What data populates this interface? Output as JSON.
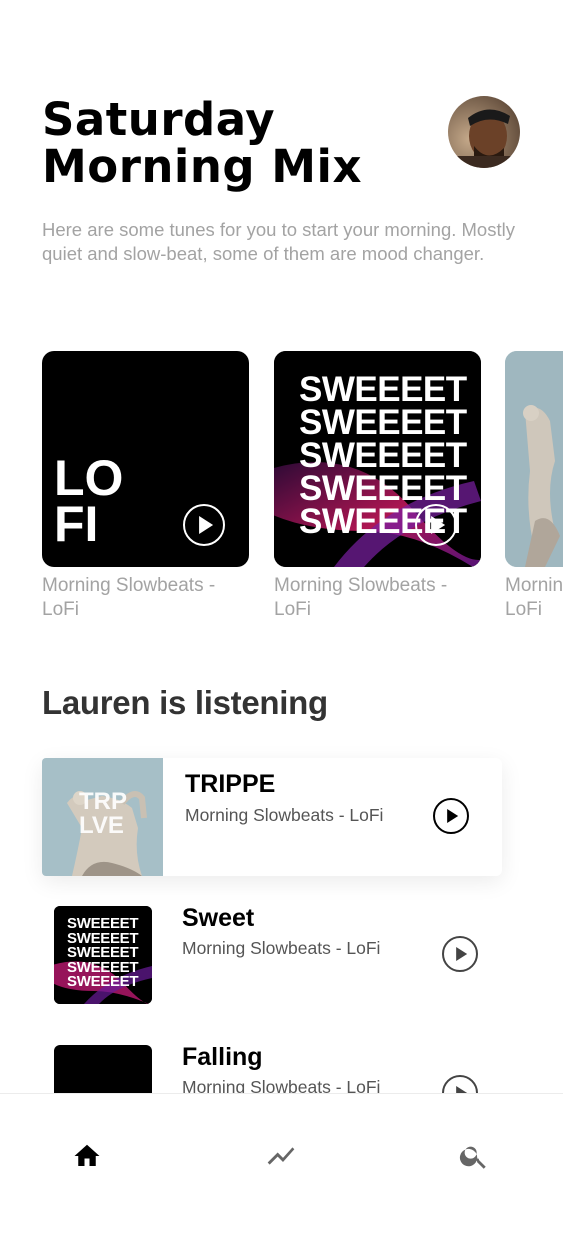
{
  "header": {
    "title_line1": "Saturday",
    "title_line2": "Morning Mix",
    "subtitle": "Here are some tunes for you to start your morning. Mostly quiet and slow-beat, some of them are mood changer."
  },
  "carousel": {
    "cards": [
      {
        "art_lines": [
          "LO",
          "FI"
        ],
        "caption": "Morning Slowbeats - LoFi",
        "icon": "play-circle-icon"
      },
      {
        "art_lines": [
          "SWEEEET",
          "SWEEEET",
          "SWEEEET",
          "SWEEEET",
          "SWEEEET"
        ],
        "caption": "Morning Slowbeats - LoFi",
        "icon": "play-circle-icon"
      },
      {
        "art_lines": [],
        "caption": "Morning Slowbeats - LoFi"
      }
    ]
  },
  "listening": {
    "heading": "Lauren is listening",
    "tracks": [
      {
        "title": "TRIPPE",
        "subtitle": "Morning Slowbeats - LoFi",
        "art_lines": [
          "TRP",
          "LVE"
        ],
        "featured": true
      },
      {
        "title": "Sweet",
        "subtitle": "Morning Slowbeats - LoFi",
        "art_lines": [
          "SWEEEET",
          "SWEEEET",
          "SWEEEET",
          "SWEEEET",
          "SWEEEET"
        ]
      },
      {
        "title": "Falling",
        "subtitle": "Morning Slowbeats - LoFi"
      }
    ]
  },
  "nav": {
    "items": [
      {
        "icon": "home-icon",
        "active": true
      },
      {
        "icon": "trending-icon",
        "active": false
      },
      {
        "icon": "search-icon",
        "active": false
      }
    ]
  },
  "colors": {
    "primary_text": "#000000",
    "secondary_text": "#a3a3a3",
    "heading": "#333333",
    "background": "#ffffff"
  }
}
